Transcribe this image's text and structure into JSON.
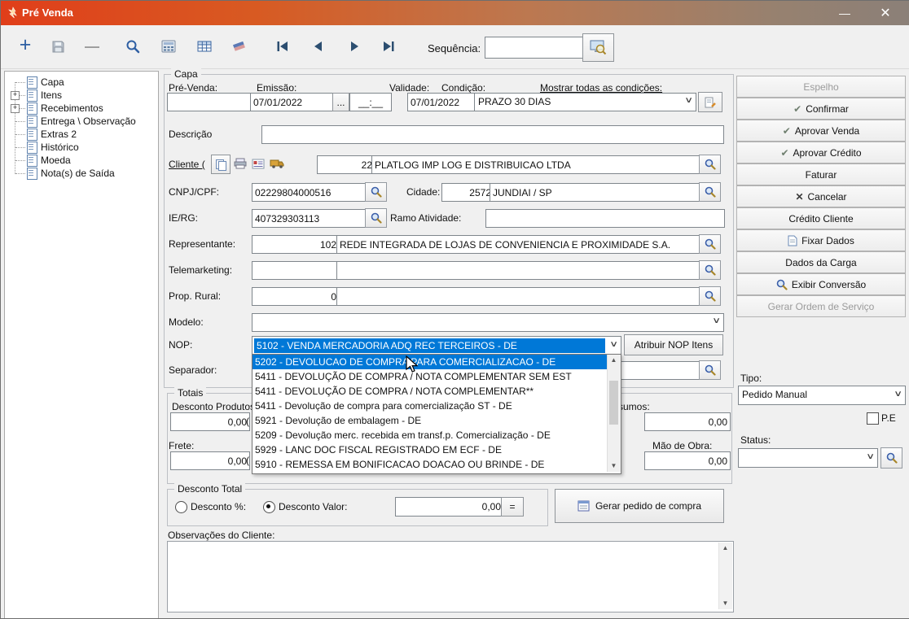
{
  "window": {
    "title": "Pré Venda",
    "minimize_glyph": "—",
    "close_glyph": "✕"
  },
  "glyphs": {
    "plus": "+",
    "minus": "—",
    "dots": "...",
    "chevron": "∨",
    "up_arrow": "▲",
    "down_arrow": "▼",
    "expand": "+",
    "check": "✔",
    "cross": "✕",
    "paren_open": "("
  },
  "toolbar": {
    "sequence_label": "Sequência:",
    "sequence_value": ""
  },
  "tree": {
    "items": [
      {
        "label": "Capa"
      },
      {
        "label": "Itens"
      },
      {
        "label": "Recebimentos"
      },
      {
        "label": "Entrega \\ Observação"
      },
      {
        "label": "Extras 2"
      },
      {
        "label": "Histórico"
      },
      {
        "label": "Moeda"
      },
      {
        "label": "Nota(s) de Saída"
      }
    ]
  },
  "capa": {
    "legend": "Capa",
    "pre_venda_label": "Pré-Venda:",
    "pre_venda_value": "",
    "emissao_label": "Emissão:",
    "emissao_value": "07/01/2022",
    "emissao_time": "__:__",
    "validade_label": "Validade:",
    "validade_value": "07/01/2022",
    "condicao_label": "Condição:",
    "condicao_value": "PRAZO 30 DIAS",
    "mostrar_condicoes_label": "Mostrar todas as condições:",
    "descricao_label": "Descrição",
    "descricao_value": "",
    "cliente_label": "Cliente (",
    "cliente_code": "22",
    "cliente_name": "PLATLOG IMP LOG E DISTRIBUICAO LTDA",
    "cnpj_label": "CNPJ/CPF:",
    "cnpj_value": "02229804000516",
    "cidade_label": "Cidade:",
    "cidade_code": "2572",
    "cidade_name": "JUNDIAI / SP",
    "ie_label": "IE/RG:",
    "ie_value": "407329303113",
    "ramo_label": "Ramo Atividade:",
    "ramo_value": "",
    "representante_label": "Representante:",
    "representante_code": "102",
    "representante_name": "REDE INTEGRADA DE LOJAS DE CONVENIENCIA E PROXIMIDADE S.A.",
    "telemarketing_label": "Telemarketing:",
    "telemarketing_code": "",
    "telemarketing_name": "",
    "prop_rural_label": "Prop. Rural:",
    "prop_rural_code": "0",
    "prop_rural_name": "",
    "modelo_label": "Modelo:",
    "modelo_value": "",
    "nop_label": "NOP:",
    "nop_value": "5102 - VENDA MERCADORIA ADQ REC TERCEIROS - DE",
    "atribuir_nop_label": "Atribuir NOP Itens",
    "separador_label": "Separador:",
    "separador_value": ""
  },
  "nop_dropdown": {
    "items": [
      "5202 - DEVOLUCAO DE COMPRA PARA COMERCIALIZACAO - DE",
      "5411 - DEVOLUÇÃO DE COMPRA / NOTA COMPLEMENTAR SEM EST",
      "5411 - DEVOLUÇÃO DE COMPRA / NOTA COMPLEMENTAR**",
      "5411 - Devolução de compra para comercialização ST - DE",
      "5921 - Devolução de embalagem - DE",
      "5209 - Devolução merc. recebida em transf.p. Comercialização - DE",
      "5929 - LANC DOC FISCAL REGISTRADO EM  ECF - DE",
      "5910 - REMESSA EM BONIFICACAO DOACAO OU BRINDE - DE"
    ]
  },
  "totais": {
    "legend": "Totais",
    "desconto_produtos_label": "Desconto Produtos:",
    "desconto_produtos_value": "0,00",
    "insumos_label": "Insumos:",
    "insumos_value": "0,00",
    "frete_label": "Frete:",
    "frete_value": "0,00",
    "mao_de_obra_label": "Mão de Obra:",
    "mao_de_obra_value": "0,00"
  },
  "desconto": {
    "legend": "Desconto Total",
    "pct_label": "Desconto %:",
    "valor_label": "Desconto Valor:",
    "valor_value": "0,00",
    "equals_label": "=",
    "gerar_pedido_label": "Gerar pedido de compra"
  },
  "observacoes": {
    "label": "Observações do Cliente:",
    "value": ""
  },
  "side": {
    "buttons": [
      {
        "label": "Espelho"
      },
      {
        "label": "Confirmar"
      },
      {
        "label": "Aprovar Venda"
      },
      {
        "label": "Aprovar Crédito"
      },
      {
        "label": "Faturar"
      },
      {
        "label": "Cancelar"
      },
      {
        "label": "Crédito Cliente"
      },
      {
        "label": "Fixar Dados"
      },
      {
        "label": "Dados da Carga"
      },
      {
        "label": "Exibir Conversão"
      },
      {
        "label": "Gerar Ordem de Serviço"
      }
    ],
    "tipo_label": "Tipo:",
    "tipo_value": "Pedido Manual",
    "pe_label": "P.E",
    "status_label": "Status:",
    "status_value": ""
  }
}
